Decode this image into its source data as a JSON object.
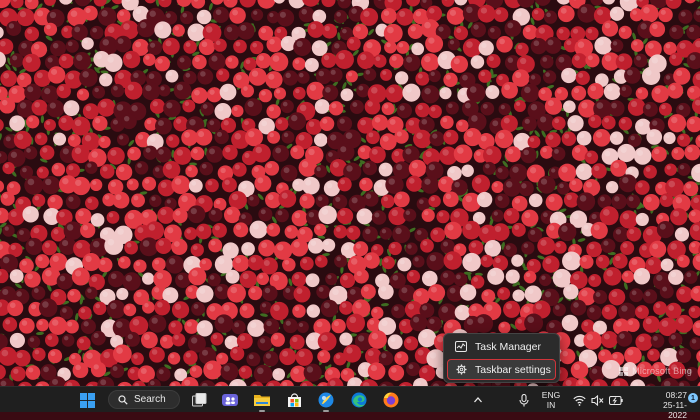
{
  "wallpaper": {
    "watermark": "Microsoft Bing",
    "colors": {
      "berry_dark": "#5a0f1a",
      "berry_red": "#c0202e",
      "berry_bright": "#e23a44",
      "berry_pale": "#f0c8c8",
      "leaf": "#3f6d22"
    }
  },
  "context_menu": {
    "items": [
      {
        "label": "Task Manager",
        "icon": "task-manager-icon"
      },
      {
        "label": "Taskbar settings",
        "icon": "gear-icon",
        "highlighted": true
      }
    ],
    "highlight_color": "#d1343a"
  },
  "taskbar": {
    "search": {
      "label": "Search"
    },
    "apps": [
      "start",
      "search",
      "task-view",
      "chat",
      "file-explorer",
      "microsoft-store",
      "chrome-like",
      "edge",
      "firefox"
    ],
    "tray": {
      "language_line1": "ENG",
      "language_line2": "IN",
      "time": "08:27",
      "date": "25-11-2022",
      "notification_count": "1"
    }
  }
}
